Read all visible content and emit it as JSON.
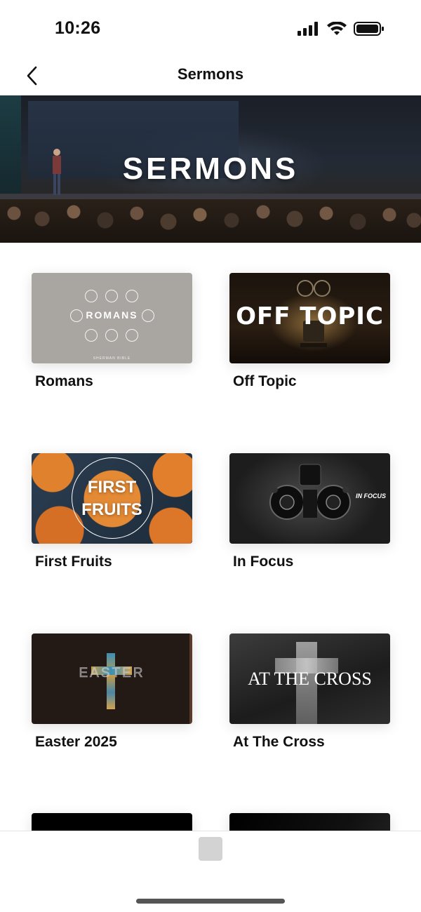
{
  "status_bar": {
    "time": "10:26"
  },
  "nav": {
    "title": "Sermons"
  },
  "hero": {
    "title": "SERMONS"
  },
  "series": [
    {
      "title": "Romans",
      "thumb_text": "ROMANS",
      "thumb_subtext": "SHERMAN BIBLE"
    },
    {
      "title": "Off Topic",
      "thumb_text": "OFF TOPIC"
    },
    {
      "title": "First Fruits",
      "thumb_text_line1": "FIRST",
      "thumb_text_line2": "FRUITS"
    },
    {
      "title": "In Focus",
      "thumb_text": "IN FOCUS"
    },
    {
      "title": "Easter 2025",
      "thumb_text": "EASTER"
    },
    {
      "title": "At The Cross",
      "thumb_text": "AT THE CROSS"
    }
  ],
  "colors": {
    "background": "#ffffff",
    "text": "#111111",
    "tab_placeholder": "#d3d3d3"
  }
}
